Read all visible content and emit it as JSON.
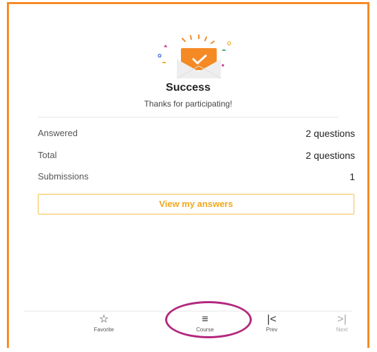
{
  "result": {
    "title": "Success",
    "subtitle": "Thanks for participating!"
  },
  "stats": [
    {
      "label": "Answered",
      "value": "2 questions"
    },
    {
      "label": "Total",
      "value": "2 questions"
    },
    {
      "label": "Submissions",
      "value": "1"
    }
  ],
  "actions": {
    "view_answers_label": "View my answers"
  },
  "bottom_nav": {
    "favorite": {
      "label": "Favorite",
      "icon": "star-outline-icon",
      "glyph": "☆"
    },
    "course": {
      "label": "Course",
      "icon": "menu-icon",
      "glyph": "≡"
    },
    "prev": {
      "label": "Prev",
      "icon": "skip-back-icon",
      "glyph": "|<"
    },
    "next": {
      "label": "Next",
      "icon": "skip-forward-icon",
      "glyph": ">|",
      "disabled": true
    }
  },
  "colors": {
    "frame_border": "#f58a24",
    "accent_orange": "#f58a24",
    "button_border": "#f6c04a",
    "button_text": "#f2a81d",
    "highlight_circle": "#b3287e"
  }
}
